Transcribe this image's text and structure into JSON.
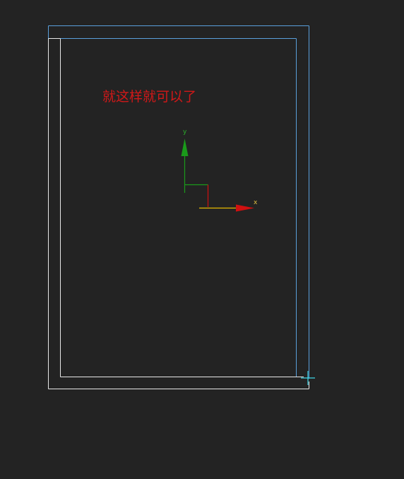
{
  "canvas": {
    "annotation": "就这样就可以了"
  },
  "axis_gizmo": {
    "x_label": "x",
    "y_label": "y"
  },
  "colors": {
    "background": "#232323",
    "selection_outline": "#5aa0dc",
    "geometry_outline": "#e8e8e8",
    "annotation_text": "#d01818",
    "axis_x_arrow": "#d01010",
    "axis_x_line": "#e6b800",
    "axis_y": "#1a9a1a",
    "x_label": "#e0c040",
    "y_label": "#2ab02a",
    "cursor": "#3fd7e8"
  },
  "icons": {
    "cursor": "crosshair-cursor-icon"
  }
}
